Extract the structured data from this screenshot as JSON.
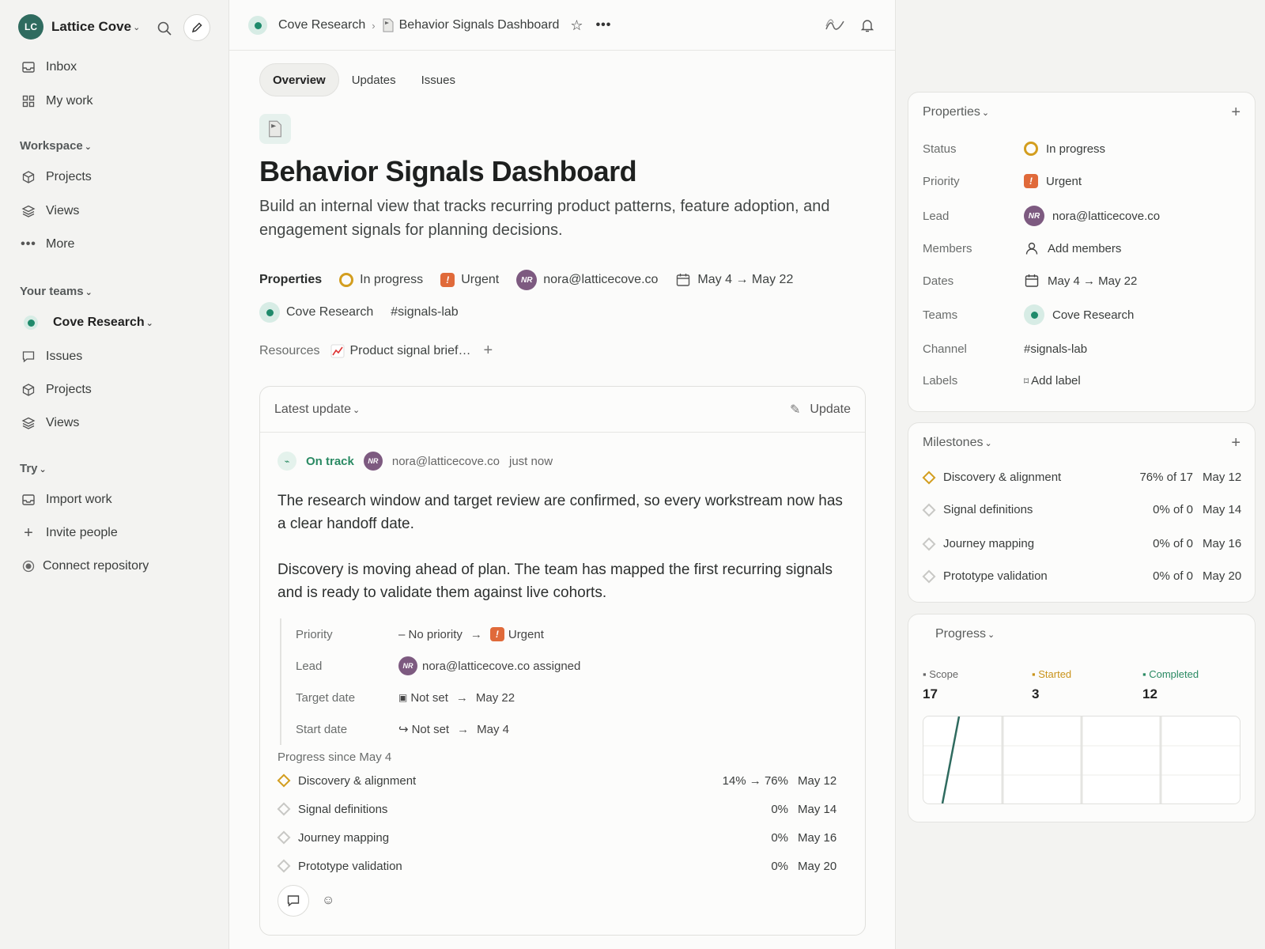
{
  "sidebar": {
    "workspace": {
      "initials": "LC",
      "name": "Lattice Cove"
    },
    "top_items": [
      {
        "label": "Inbox",
        "icon": "inbox-icon"
      },
      {
        "label": "My work",
        "icon": "grid-icon"
      }
    ],
    "workspace_label": "Workspace",
    "workspace_items": [
      {
        "label": "Projects",
        "icon": "cube-icon"
      },
      {
        "label": "Views",
        "icon": "layers-icon"
      },
      {
        "label": "More",
        "icon": "more-icon"
      }
    ],
    "teams_label": "Your teams",
    "team_name": "Cove Research",
    "team_items": [
      {
        "label": "Issues",
        "icon": "comment-icon"
      },
      {
        "label": "Projects",
        "icon": "cube-icon"
      },
      {
        "label": "Views",
        "icon": "layers-icon"
      }
    ],
    "try_label": "Try",
    "try_items": [
      {
        "label": "Import work",
        "icon": "inbox-icon"
      },
      {
        "label": "Invite people",
        "icon": "plus-icon"
      },
      {
        "label": "Connect repository",
        "icon": "dot-icon"
      }
    ]
  },
  "header": {
    "team": "Cove Research",
    "project": "Behavior Signals Dashboard"
  },
  "tabs": [
    "Overview",
    "Updates",
    "Issues"
  ],
  "project": {
    "title": "Behavior Signals Dashboard",
    "description": "Build an internal view that tracks recurring product patterns, feature adoption, and engagement signals for planning decisions.",
    "properties_label": "Properties",
    "status": "In progress",
    "priority": "Urgent",
    "lead": "nora@latticecove.co",
    "lead_initials": "NR",
    "dates": "May 4 → May 22",
    "team": "Cove Research",
    "channel": "#signals-lab",
    "resources_label": "Resources",
    "resource": "Product signal brief…"
  },
  "update": {
    "header_label": "Latest update",
    "update_button": "Update",
    "health": "On track",
    "author": "nora@latticecove.co",
    "author_initials": "NR",
    "time": "just now",
    "paragraph1": "The research window and target review are confirmed, so every workstream now has a clear handoff date.",
    "paragraph2": "Discovery is moving ahead of plan. The team has mapped the first recurring signals and is ready to validate them against live cohorts.",
    "changes": {
      "priority_label": "Priority",
      "priority_from": "– No priority",
      "priority_to": "Urgent",
      "lead_label": "Lead",
      "lead_text": "nora@latticecove.co assigned",
      "target_label": "Target date",
      "target_from": "Not set",
      "target_to": "May 22",
      "start_label": "Start date",
      "start_from": "Not set",
      "start_to": "May 4"
    },
    "since_label": "Progress since May 4",
    "milestones": [
      {
        "name": "Discovery & alignment",
        "pct": "14% → 76%",
        "date": "May 12",
        "active": true
      },
      {
        "name": "Signal definitions",
        "pct": "0%",
        "date": "May 14",
        "active": false
      },
      {
        "name": "Journey mapping",
        "pct": "0%",
        "date": "May 16",
        "active": false
      },
      {
        "name": "Prototype validation",
        "pct": "0%",
        "date": "May 20",
        "active": false
      }
    ]
  },
  "properties_panel": {
    "title": "Properties",
    "status_label": "Status",
    "status": "In progress",
    "priority_label": "Priority",
    "priority": "Urgent",
    "lead_label": "Lead",
    "lead": "nora@latticecove.co",
    "lead_initials": "NR",
    "members_label": "Members",
    "members": "Add members",
    "dates_label": "Dates",
    "dates": "May 4 → May 22",
    "teams_label": "Teams",
    "teams": "Cove Research",
    "channel_label": "Channel",
    "channel": "#signals-lab",
    "labels_label": "Labels",
    "labels": "Add label"
  },
  "milestones_panel": {
    "title": "Milestones",
    "items": [
      {
        "name": "Discovery & alignment",
        "pct": "76% of 17",
        "date": "May 12",
        "active": true
      },
      {
        "name": "Signal definitions",
        "pct": "0% of 0",
        "date": "May 14",
        "active": false
      },
      {
        "name": "Journey mapping",
        "pct": "0% of 0",
        "date": "May 16",
        "active": false
      },
      {
        "name": "Prototype validation",
        "pct": "0% of 0",
        "date": "May 20",
        "active": false
      }
    ]
  },
  "progress_panel": {
    "title": "Progress",
    "scope_label": "Scope",
    "scope": "17",
    "started_label": "Started",
    "started": "3",
    "completed_label": "Completed",
    "completed": "12"
  },
  "colors": {
    "accent_green": "#2a8a63",
    "status_yellow": "#d39e1f",
    "urgent_orange": "#e06a3a",
    "avatar_purple": "#7d5a80"
  }
}
